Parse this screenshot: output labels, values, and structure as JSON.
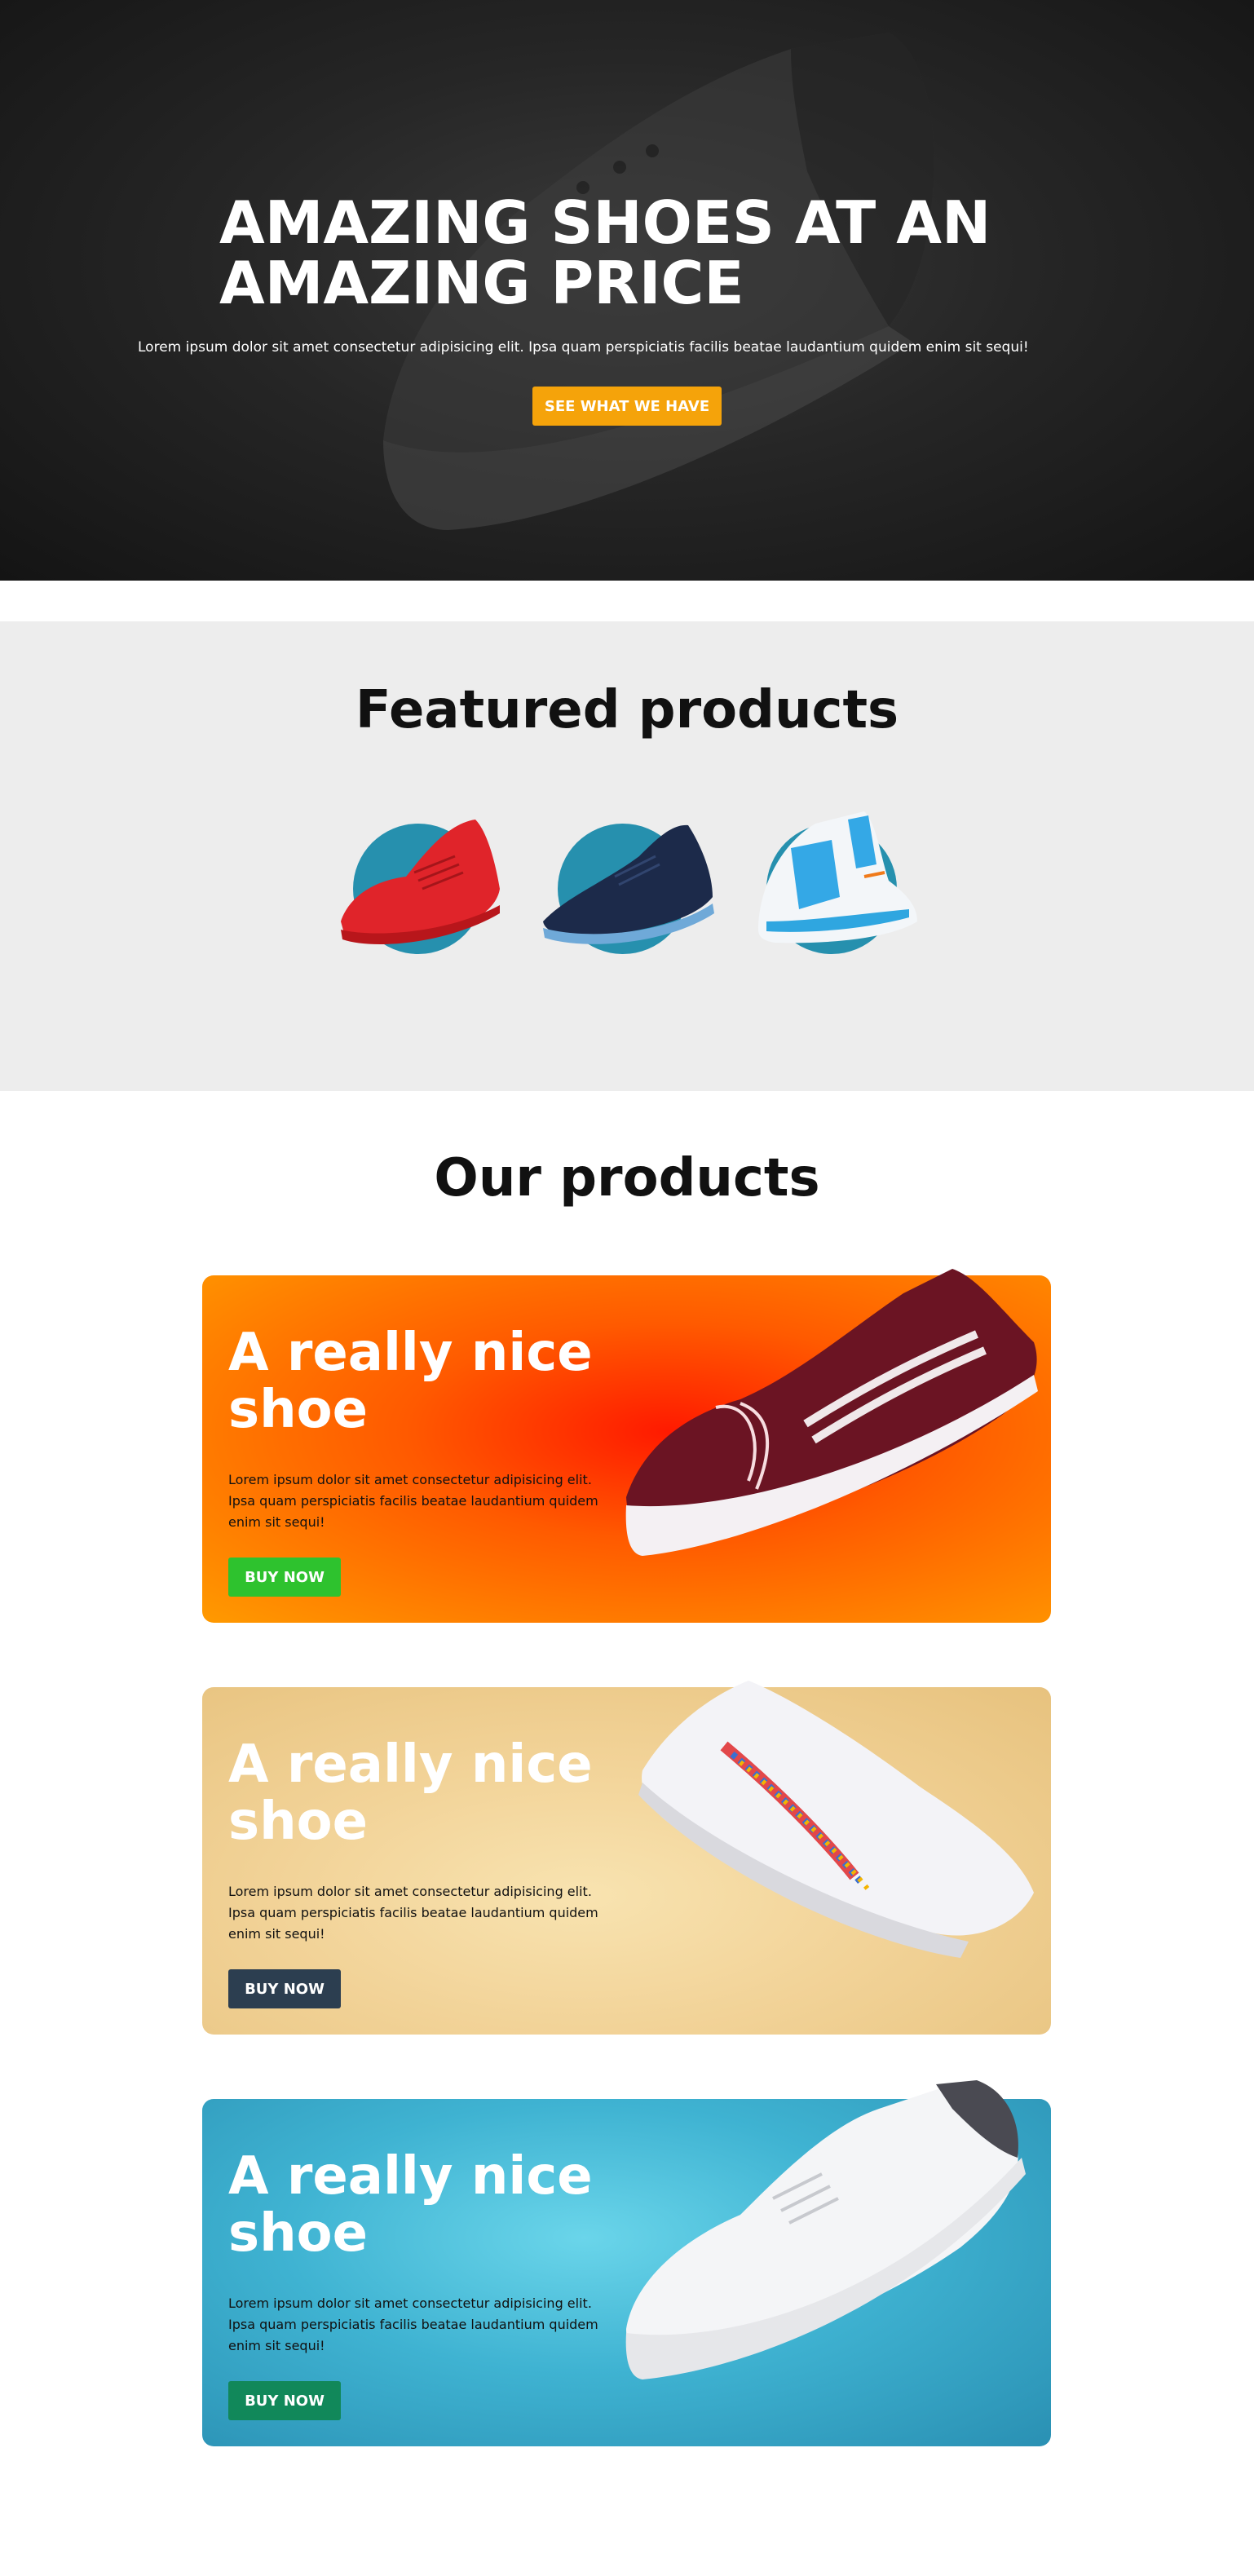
{
  "hero": {
    "title": "AMAZING SHOES AT AN AMAZING PRICE",
    "subtitle": "Lorem ipsum dolor sit amet consectetur adipisicing elit. Ipsa quam perspiciatis facilis beatae laudantium quidem enim sit sequi!",
    "cta_label": "SEE WHAT WE HAVE",
    "cta_color": "#f5a30a"
  },
  "featured": {
    "title": "Featured products",
    "items": [
      {
        "name": "red-high-top-sneaker",
        "color": "#e0242a"
      },
      {
        "name": "navy-running-shoe",
        "color": "#1c2a4a"
      },
      {
        "name": "blue-white-high-top",
        "color": "#2fa6e0"
      }
    ],
    "circle_color": "#2690ae"
  },
  "products": {
    "title": "Our products",
    "cards": [
      {
        "title": "A really nice shoe",
        "description": "Lorem ipsum dolor sit amet consectetur adipisicing elit. Ipsa quam perspiciatis facilis beatae laudantium quidem enim sit sequi!",
        "button_label": "BUY NOW",
        "button_color": "#2ec22e",
        "shoe": "maroon-canvas-sneaker"
      },
      {
        "title": "A really nice shoe",
        "description": "Lorem ipsum dolor sit amet consectetur adipisicing elit. Ipsa quam perspiciatis facilis beatae laudantium quidem enim sit sequi!",
        "button_label": "BUY NOW",
        "button_color": "#2c3e50",
        "shoe": "white-puma-sneaker"
      },
      {
        "title": "A really nice shoe",
        "description": "Lorem ipsum dolor sit amet consectetur adipisicing elit. Ipsa quam perspiciatis facilis beatae laudantium quidem enim sit sequi!",
        "button_label": "BUY NOW",
        "button_color": "#11885a",
        "shoe": "white-leather-sneaker"
      }
    ]
  }
}
